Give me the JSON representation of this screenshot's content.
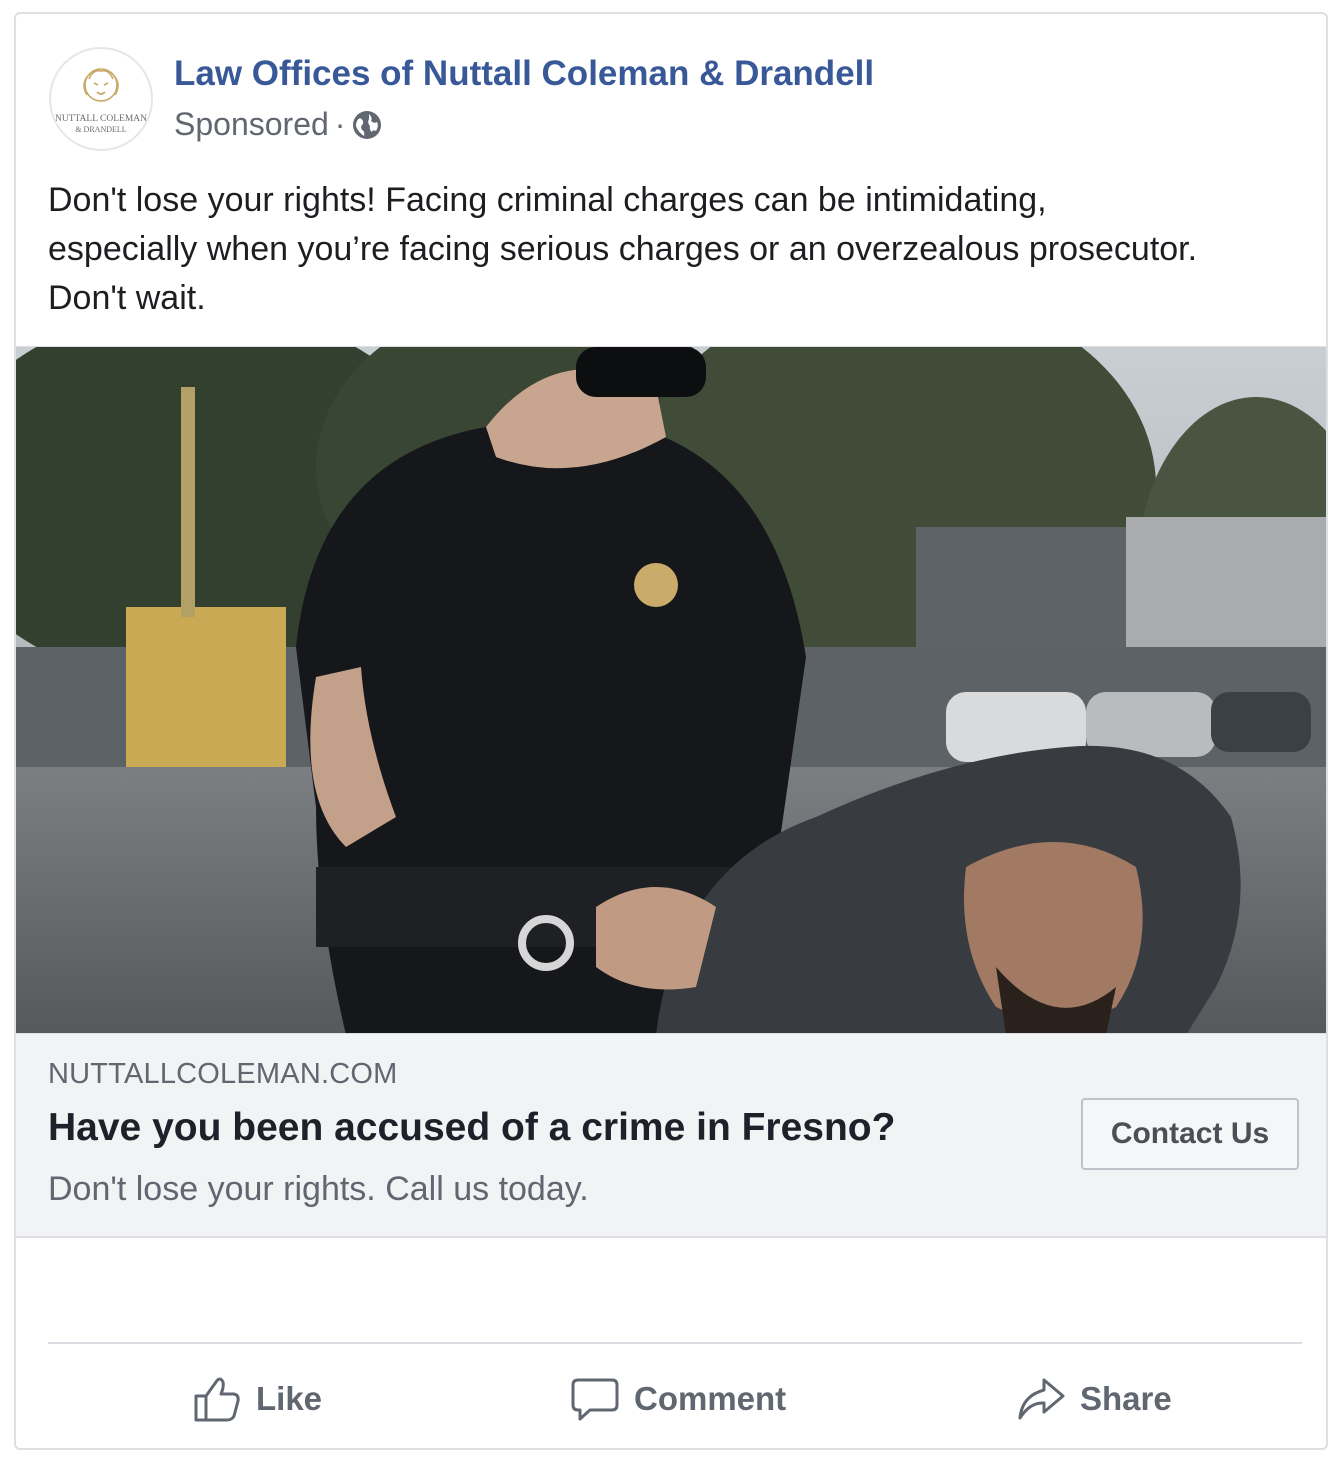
{
  "post": {
    "page_name": "Law Offices of Nuttall Coleman & Drandell",
    "sponsored_label": "Sponsored",
    "separator": "·",
    "avatar_logo_text": [
      "NUTTALL COLEMAN",
      "& DRANDELL"
    ],
    "text_lines": [
      "Don't lose your rights! Facing criminal charges can be intimidating,",
      "especially when you’re facing serious charges or an overzealous prosecutor.",
      "Don't wait."
    ]
  },
  "link_preview": {
    "domain": "NUTTALLCOLEMAN.COM",
    "headline": "Have you been accused of a crime in Fresno?",
    "description": "Don't lose your rights. Call us today.",
    "cta_label": "Contact Us"
  },
  "actions": {
    "like_label": "Like",
    "comment_label": "Comment",
    "share_label": "Share"
  },
  "icons": {
    "privacy": "globe-icon",
    "like": "thumbs-up-icon",
    "comment": "speech-bubble-icon",
    "share": "share-arrow-icon"
  },
  "colors": {
    "page_name": "#385898",
    "secondary_text": "#606770",
    "link_box_bg": "#f2f3f5",
    "border": "#dddfe2"
  }
}
